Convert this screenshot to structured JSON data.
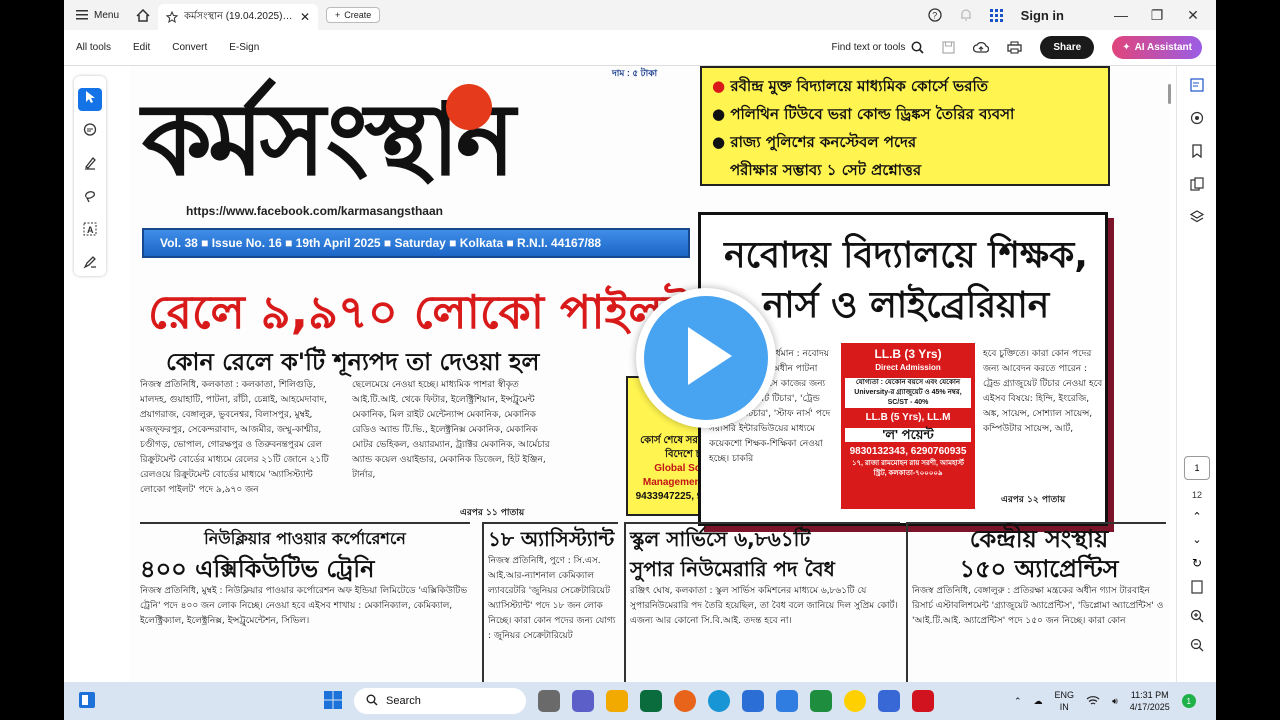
{
  "titlebar": {
    "menu_label": "Menu",
    "tab_title": "কর্মসংস্থান (19.04.2025)_s...",
    "create_label": "Create",
    "signin_label": "Sign in"
  },
  "menubar": {
    "items": [
      "All tools",
      "Edit",
      "Convert",
      "E-Sign"
    ],
    "find_label": "Find text or tools",
    "share_label": "Share",
    "ai_label": "AI Assistant"
  },
  "pagenav": {
    "current_page": "1",
    "total_pages": "12"
  },
  "document": {
    "masthead": "কর্মসংস্থান",
    "price": "দাম : ৫ টাকা",
    "facebook_url": "https://www.facebook.com/karmasangsthaan",
    "volume_line": "Vol. 38 ■ Issue No. 16 ■ 19th April 2025 ■ Saturday ■ Kolkata ■ R.N.I. 44167/88",
    "headline_red": "রেলে ৯,৯৭০ লোকো পাইলট",
    "subhead": "কোন রেলে ক'টি শূন্যপদ তা দেওয়া হল",
    "body_left": "নিজস্ব প্রতিনিধি, কলকাতা : কলকাতা, শিলিগুড়ি, মালদহ, গুয়াহাটি, পাটনা, রাঁচী, চেন্নাই, আহমেদাবাদ, প্রয়াগরাজ, বেঙ্গালুরু, ভুবনেশ্বর, বিলাসপুর, মুম্বই, মজফ্ফরপুর, সেকেন্দরাবাদ, আজমীর, জম্মু-কাশ্মীর, চণ্ডীগড়, ভোপাল, গোরক্ষপুর ও তিরুবনন্তপুরম রেল রিক্রুটমেন্ট বোর্ডের মাধ্যমে রেলের ২১টি জোনে ২১টি রেলওয়ে রিক্রুটমেন্ট বোর্ডের মাধ্যমে 'অ্যাসিস্ট্যান্ট লোকো পাইলট' পদে ৯,৯৭০ জন",
    "body_mid": "ছেলেমেয়ে নেওয়া হচ্ছে। মাধ্যমিক পাশরা স্বীকৃত আই.টি.আই. থেকে ফিটার, ইলেক্ট্রিশিয়ান, ইন্সট্রুমেন্ট মেকানিক, মিল রাইট মেন্টেন্যান্স মেকানিক, মেকানিক রেডিও অ্যান্ড টি.ভি., ইলেক্ট্রনিক্স মেকানিক, মেকানিক মোটর ভেহিকল, ওয়্যারম্যান, ট্র্যাক্টর মেকানিক, আর্মেচার অ্যান্ড কয়েল ওয়াইন্ডার, মেকানিক ডিজেল, হিট ইঞ্জিন, টার্নার,",
    "continued_mid": "এরপর ১১ পাতায়",
    "yellow_items": [
      "রবীন্দ্র মুক্ত বিদ্যালয়ে মাধ্যমিক কোর্সে ভরতি",
      "পলিথিন টিউবে ভরা কোল্ড ড্রিঙ্কস তৈরির ব্যবসা",
      "রাজ্য পুলিশের কনস্টেবল পদের",
      "পরীক্ষার সম্ভাব্য ১ সেট প্রশ্নোত্তর"
    ],
    "nabodaya_title": "নবোদয় বিদ্যালয়ে শিক্ষক, নার্স ও লাইব্রেরিয়ান",
    "nabodaya_body_left": "নিজস্ব প্রতিনিধি, বর্ধমান : নবোদয় বিদ্যালয় সমিতির অধীন পাটনা রিজিওনাল অফিসে কাজের জন্য 'পোস্ট-গ্র্যাজুয়েট টিচার', 'ট্রেন্ড গ্র্যাজুয়েট টিচার', 'স্টাফ নার্স' পদে সরাসরি ইন্টারভিউয়ের মাধ্যমে কয়েকশো শিক্ষক-শিক্ষিকা নেওয়া হচ্ছে। চাকরি",
    "nabodaya_body_right": "হবে চুক্তিতে। কারা কোন পদের জন্য আবেদন করতে পারেন : ট্রেন্ড গ্র্যাজুয়েট টিচার নেওয়া হবে এইসব বিষয়ে: হিন্দি, ইংরেজি, অঙ্ক, সায়েন্স, সোশ্যাল সায়েন্স, কম্পিউটার সায়েন্স, আর্ট,",
    "nabodaya_continued": "এরপর ১২ পাতায়",
    "llb": {
      "line1": "LL.B (3 Yrs)",
      "line2": "Direct Admission",
      "line3": "যোগ্যতা : যেকোন বয়সে এবং যেকোন University-র গ্র্যাজুয়েট ও 45% নম্বর, SC/ST - 40%",
      "line4": "LL.B (5 Yrs), LL.M",
      "line5": "'ল' পয়েন্ট",
      "line6": "9830132343, 6290760935",
      "line7": "১৭, রাজা রামমোহন রায় সরণী, আমহার্স্ট স্ট্রিট, কলকাতা-৭০০০০৯"
    },
    "ad_yellow": {
      "line1": "কোর্স শেষে সরাসরি দেশে ও বিদেশে চাকরি।",
      "line2": "Global School of Management, Kalyani",
      "line3": "9433947225, 9062269582"
    },
    "row2": [
      {
        "title1": "নিউক্লিয়ার পাওয়ার কর্পোরেশনে",
        "title2": "৪০০ এক্সিকিউটিভ ট্রেনি",
        "body": "নিজস্ব প্রতিনিধি, মুম্বই : নিউক্লিয়ার পাওয়ার কর্পোরেশন অফ ইন্ডিয়া লিমিটেডে 'এক্সিকিউটিভ ট্রেনি' পদে ৪০০ জন লোক নিচ্ছে। নেওয়া হবে এইসব শাখায় : মেকানিক্যাল, কেমিক্যাল, ইলেক্ট্রিক্যাল, ইলেক্ট্রনিক্স, ইন্সট্রুমেন্টেশন, সিভিল।"
      },
      {
        "title1": "১৮ অ্যাসিস্ট্যান্ট",
        "title2": "",
        "body": "নিজস্ব প্রতিনিধি, পুণে : সি.এস. আই.আর-ন্যাশনাল কেমিক্যাল ল্যাবরেটরি 'জুনিয়র সেক্রেটারিয়েট অ্যাসিস্ট্যান্ট' পদে ১৮ জন লোক নিচ্ছে। কারা কোন পদের জন্য যোগ্য : জুনিয়র সেক্রেটারিয়েট"
      },
      {
        "title1": "স্কুল সার্ভিসে ৬,৮৬১টি",
        "title2": "সুপার নিউমেরারি পদ বৈধ",
        "body": "রঞ্জিৎ ঘোষ, কলকাতা : স্কুল সার্ভিস কমিশনের মাধ্যমে ৬,৮৬১টি যে সুপারনিউমেরারি পদ তৈরি হয়েছিল, তা বৈধ বলে জানিয়ে দিল সুপ্রিম কোর্ট। এজন্য আর কোনো সি.বি.আই. তদন্ত হবে না।"
      },
      {
        "title1": "কেন্দ্রীয় সংস্থায়",
        "title2": "১৫০ অ্যাপ্রেন্টিস",
        "body": "নিজস্ব প্রতিনিধি, বেঙ্গালুরু : প্রতিরক্ষা মন্ত্রকের অধীন গ্যাস টারবাইন রিসার্চ এস্টাবলিশমেন্ট 'গ্র্যাজুয়েট অ্যাপ্রেন্টিস', 'ডিপ্লোমা অ্যাপ্রেন্টিস' ও 'আই.টি.আই. অ্যাপ্রেন্টিস' পদে ১৫০ জন নিচ্ছে। কারা কোন"
      }
    ]
  },
  "taskbar": {
    "search_label": "Search",
    "lang_line1": "ENG",
    "lang_line2": "IN",
    "time": "11:31 PM",
    "date": "4/17/2025",
    "notif_count": "1"
  }
}
